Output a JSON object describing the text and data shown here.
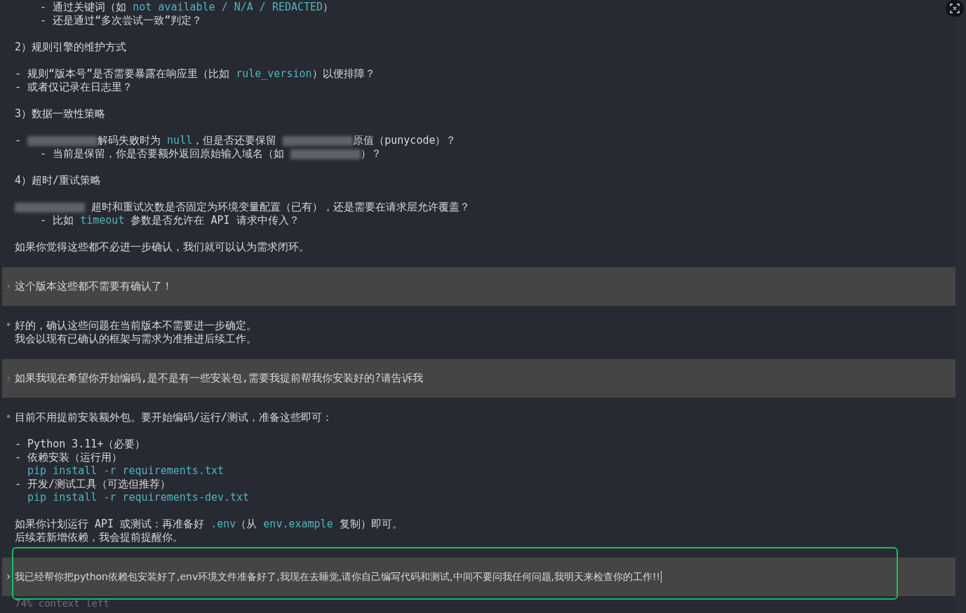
{
  "messages": [
    {
      "kind": "assistant",
      "paragraphs": [
        [
          {
            "nested": true,
            "segments": [
              {
                "kind": "text",
                "text": "- 通过关键词（如 "
              },
              {
                "kind": "code",
                "text": "not available / N/A / REDACTED"
              },
              {
                "kind": "text",
                "text": "）"
              }
            ]
          },
          {
            "nested": true,
            "segments": [
              {
                "kind": "text",
                "text": "- 还是通过“多次尝试一致”判定？"
              }
            ]
          }
        ],
        [
          {
            "segments": [
              {
                "kind": "text",
                "text": "2）规则引擎的维护方式"
              }
            ]
          }
        ],
        [
          {
            "segments": [
              {
                "kind": "text",
                "text": "- 规则“版本号”是否需要暴露在响应里（比如 "
              },
              {
                "kind": "code",
                "text": "rule_version"
              },
              {
                "kind": "text",
                "text": "）以便排障？"
              }
            ]
          },
          {
            "segments": [
              {
                "kind": "text",
                "text": "- 或者仅记录在日志里？"
              }
            ]
          }
        ],
        [
          {
            "segments": [
              {
                "kind": "text",
                "text": "3）数据一致性策略"
              }
            ]
          }
        ],
        [
          {
            "segments": [
              {
                "kind": "text",
                "text": "- "
              },
              {
                "kind": "redacted"
              },
              {
                "kind": "text",
                "text": "解码失败时为 "
              },
              {
                "kind": "code",
                "text": "null"
              },
              {
                "kind": "text",
                "text": "，但是否还要保留 "
              },
              {
                "kind": "redacted"
              },
              {
                "kind": "text",
                "text": "原值（punycode）？"
              }
            ]
          },
          {
            "nested": true,
            "segments": [
              {
                "kind": "text",
                "text": "- 当前是保留，你是否要额外返回原始输入域名（如 "
              },
              {
                "kind": "redacted"
              },
              {
                "kind": "text",
                "text": "）？"
              }
            ]
          }
        ],
        [
          {
            "segments": [
              {
                "kind": "text",
                "text": "4）超时/重试策略"
              }
            ]
          }
        ],
        [
          {
            "segments": [
              {
                "kind": "redacted"
              },
              {
                "kind": "text",
                "text": " 超时和重试次数是否固定为环境变量配置（已有），还是需要在请求层允许覆盖？"
              }
            ]
          },
          {
            "nested": true,
            "segments": [
              {
                "kind": "text",
                "text": "- 比如 "
              },
              {
                "kind": "code",
                "text": "timeout"
              },
              {
                "kind": "text",
                "text": " 参数是否允许在 API 请求中传入？"
              }
            ]
          }
        ],
        [
          {
            "segments": [
              {
                "kind": "text",
                "text": "如果你觉得这些都不必进一步确认，我们就可以认为需求闭环。"
              }
            ]
          }
        ]
      ]
    },
    {
      "kind": "user",
      "marker": "›",
      "paragraphs": [
        [
          {
            "segments": [
              {
                "kind": "text",
                "text": "这个版本这些都不需要有确认了！"
              }
            ]
          }
        ]
      ]
    },
    {
      "kind": "assistant",
      "marker": "•",
      "paragraphs": [
        [
          {
            "segments": [
              {
                "kind": "text",
                "text": "好的，确认这些问题在当前版本不需要进一步确定。"
              }
            ]
          },
          {
            "segments": [
              {
                "kind": "text",
                "text": "我会以现有已确认的框架与需求为准推进后续工作。"
              }
            ]
          }
        ]
      ]
    },
    {
      "kind": "user",
      "marker": "›",
      "paragraphs": [
        [
          {
            "segments": [
              {
                "kind": "text",
                "text": "如果我现在希望你开始编码,是不是有一些安装包,需要我提前帮我你安装好的?请告诉我"
              }
            ]
          }
        ]
      ]
    },
    {
      "kind": "assistant",
      "marker": "•",
      "paragraphs": [
        [
          {
            "segments": [
              {
                "kind": "text",
                "text": "目前不用提前安装额外包。要开始编码/运行/测试，准备这些即可："
              }
            ]
          }
        ],
        [
          {
            "segments": [
              {
                "kind": "text",
                "text": "- Python 3.11+（必要）"
              }
            ]
          },
          {
            "segments": [
              {
                "kind": "text",
                "text": "- 依赖安装（运行用）"
              }
            ]
          },
          {
            "continuation": true,
            "segments": [
              {
                "kind": "code",
                "text": "pip install -r requirements.txt"
              }
            ]
          },
          {
            "segments": [
              {
                "kind": "text",
                "text": "- 开发/测试工具（可选但推荐）"
              }
            ]
          },
          {
            "continuation": true,
            "segments": [
              {
                "kind": "code",
                "text": "pip install -r requirements-dev.txt"
              }
            ]
          }
        ],
        [
          {
            "segments": [
              {
                "kind": "text",
                "text": "如果你计划运行 API 或测试：再准备好 "
              },
              {
                "kind": "code",
                "text": ".env"
              },
              {
                "kind": "text",
                "text": "（从 "
              },
              {
                "kind": "code",
                "text": "env.example"
              },
              {
                "kind": "text",
                "text": " 复制）即可。"
              }
            ]
          },
          {
            "segments": [
              {
                "kind": "text",
                "text": "后续若新增依赖，我会提前提醒你。"
              }
            ]
          }
        ]
      ]
    }
  ],
  "composer": {
    "prompt": "›",
    "value": "我已经帮你把python依赖包安装好了,env环境文件准备好了,我现在去睡觉,请你自己编写代码和测试,中间不要问我任何问题,我明天来检查你的工作!!",
    "highlighted": true
  },
  "status": "74% context left"
}
